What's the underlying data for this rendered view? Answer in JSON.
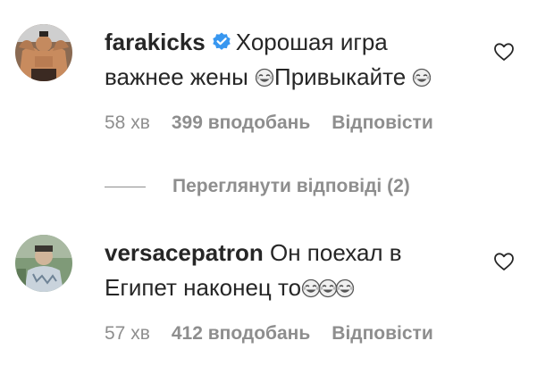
{
  "comments": [
    {
      "username": "farakicks",
      "verified": true,
      "text_line1": "Хорошая игра",
      "text_line2": "важнее жены",
      "text_line2b": "Привыкайте",
      "time": "58 хв",
      "likes": "399 вподобань",
      "reply_label": "Відповісти",
      "view_replies_label": "Переглянути відповіді (2)"
    },
    {
      "username": "versacepatron",
      "verified": false,
      "text_line1": "Он поехал в",
      "text_line2": "Египет наконец то",
      "time": "57 хв",
      "likes": "412 вподобань",
      "reply_label": "Відповісти"
    }
  ],
  "icons": {
    "like": "heart-outline-icon",
    "verified": "verified-badge-icon",
    "emoji": "face-with-tears-of-joy-emoji"
  },
  "colors": {
    "text": "#262626",
    "secondary": "#8e8e8e",
    "verified": "#3897f0"
  }
}
